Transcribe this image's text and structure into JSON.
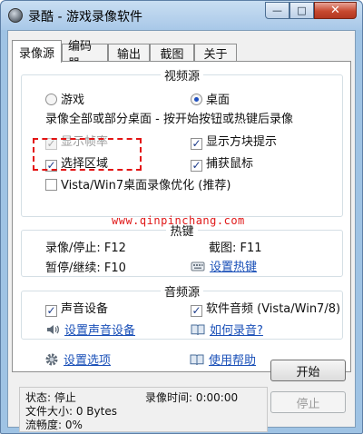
{
  "window": {
    "title": "录酷 - 游戏录像软件",
    "minimize_glyph": "—",
    "maximize_glyph": "□",
    "close_glyph": "✕"
  },
  "tabs": [
    {
      "label": "录像源",
      "active": true
    },
    {
      "label": "编码器",
      "active": false
    },
    {
      "label": "输出",
      "active": false
    },
    {
      "label": "截图",
      "active": false
    },
    {
      "label": "关于",
      "active": false
    }
  ],
  "video_source": {
    "title": "视频源",
    "radio_game": "游戏",
    "radio_desktop": "桌面",
    "selected": "桌面",
    "description": "录像全部或部分桌面 - 按开始按钮或热键后录像",
    "show_fps": {
      "label": "显示帧率",
      "checked": true,
      "enabled": false
    },
    "show_box_hint": {
      "label": "显示方块提示",
      "checked": true
    },
    "select_region": {
      "label": "选择区域",
      "checked": true
    },
    "capture_mouse": {
      "label": "捕获鼠标",
      "checked": true
    },
    "aero_optimize": {
      "label": "Vista/Win7桌面录像优化 (推荐)",
      "checked": false
    }
  },
  "hotkeys": {
    "title": "热键",
    "record_stop_label": "录像/停止: F12",
    "screenshot_label": "截图: F11",
    "pause_resume_label": "暂停/继续: F10",
    "set_hotkeys_link": "设置热键"
  },
  "audio_source": {
    "title": "音频源",
    "sound_device": {
      "label": "声音设备",
      "checked": true
    },
    "software_audio": {
      "label": "软件音频 (Vista/Win7/8)",
      "checked": true
    },
    "set_sound_device_link": "设置声音设备",
    "how_to_record_link": "如何录音?"
  },
  "bottom_links": {
    "settings_link": "设置选项",
    "help_link": "使用帮助"
  },
  "status": {
    "state": "状态: 停止",
    "record_time": "录像时间: 0:00:00",
    "file_size": "文件大小: 0 Bytes",
    "smoothness": "流畅度: 0%"
  },
  "buttons": {
    "start": "开始",
    "stop": "停止"
  },
  "watermark": "www.qinpinchang.com",
  "colors": {
    "link": "#1a50b8",
    "annotation": "#e31414",
    "titlebar": "#a8c8e8"
  }
}
